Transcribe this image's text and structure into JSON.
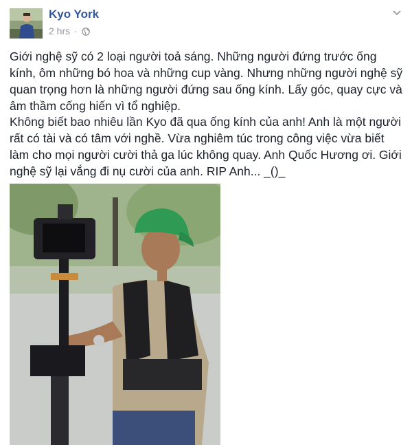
{
  "post": {
    "author": "Kyo York",
    "time": "2 hrs",
    "separator": "·",
    "privacy_icon": "globe-icon",
    "menu_icon": "chevron-down-icon",
    "paragraphs": [
      "Giới nghệ sỹ có 2 loại người toả sáng. Những người đứng trước ống kính, ôm những bó hoa và những cup vàng. Nhưng những người nghệ sỹ quan trọng hơn là những người đứng sau ống kính. Lấy góc, quay cực và âm thầm cống hiến vì tổ nghiệp.",
      "Không biết bao nhiêu lần Kyo đã qua ống kính của anh! Anh là một người rất có tài và có tâm với nghề. Vừa nghiêm túc trong công việc vừa biết làm cho mọi người cười thả ga lúc không quay. Anh Quốc Hương ơi. Giới nghệ sỹ lại vắng đi nụ cười của anh. RIP Anh... _()_"
    ],
    "photo": "cameraman-photo"
  },
  "colors": {
    "author_link": "#365899",
    "meta_text": "#90949c",
    "body_text": "#1d2129"
  }
}
